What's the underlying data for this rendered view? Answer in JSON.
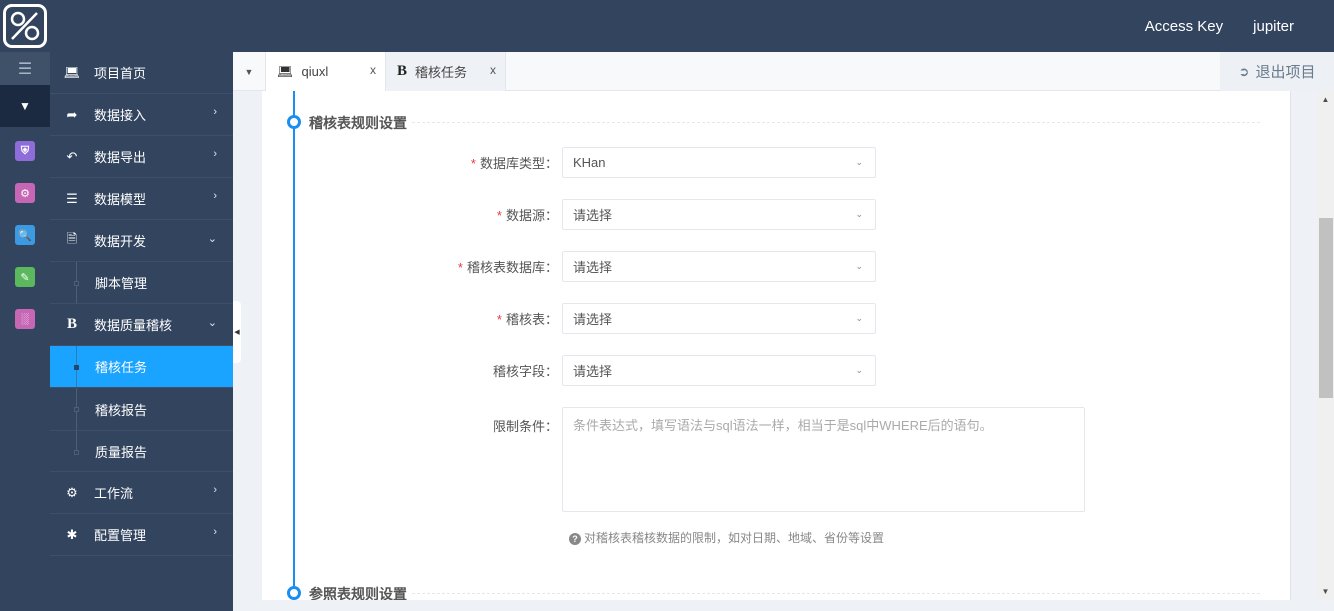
{
  "header": {
    "logo_icon": "percent-logo",
    "access_key_label": "Access Key",
    "username": "jupiter"
  },
  "rail": {
    "items": [
      {
        "icon": "shield-icon",
        "color": "#8e6ddb"
      },
      {
        "icon": "calendar-gear-icon",
        "color": "#c667b5"
      },
      {
        "icon": "folder-search-icon",
        "color": "#3b9ae1"
      },
      {
        "icon": "database-edit-icon",
        "color": "#5cb85c"
      },
      {
        "icon": "bar-chart-icon",
        "color": "#c667b5"
      }
    ]
  },
  "sidebar": {
    "items": [
      {
        "label": "项目首页",
        "icon": "monitor-icon",
        "arrow": ""
      },
      {
        "label": "数据接入",
        "icon": "share-icon",
        "arrow": "›"
      },
      {
        "label": "数据导出",
        "icon": "reply-icon",
        "arrow": "›"
      },
      {
        "label": "数据模型",
        "icon": "database-icon",
        "arrow": "›"
      },
      {
        "label": "数据开发",
        "icon": "file-code-icon",
        "arrow": "⌄"
      },
      {
        "label": "数据质量稽核",
        "icon": "bold-b-icon",
        "arrow": "⌄"
      },
      {
        "label": "工作流",
        "icon": "cogs-icon",
        "arrow": "›"
      },
      {
        "label": "配置管理",
        "icon": "gear-icon",
        "arrow": "›"
      }
    ],
    "dev_sub": [
      {
        "label": "脚本管理"
      }
    ],
    "quality_sub": [
      {
        "label": "稽核任务",
        "active": true
      },
      {
        "label": "稽核报告",
        "active": false
      },
      {
        "label": "质量报告",
        "active": false
      }
    ]
  },
  "tabs": [
    {
      "label": "qiuxl",
      "icon": "monitor-icon",
      "close": "x"
    },
    {
      "label": "稽核任务",
      "icon": "bold-b-icon",
      "close": "x"
    }
  ],
  "exit_button": {
    "label": "退出项目",
    "icon": "sign-out-icon"
  },
  "form": {
    "section1_title": "稽核表规则设置",
    "section2_title": "参照表规则设置",
    "fields": [
      {
        "label": "数据库类型：",
        "required": true,
        "value": "KHan"
      },
      {
        "label": "数据源：",
        "required": true,
        "value": "请选择"
      },
      {
        "label": "稽核表数据库：",
        "required": true,
        "value": "请选择"
      },
      {
        "label": "稽核表：",
        "required": true,
        "value": "请选择"
      },
      {
        "label": "稽核字段：",
        "required": false,
        "value": "请选择"
      }
    ],
    "condition": {
      "label": "限制条件：",
      "placeholder": "条件表达式，填写语法与sql语法一样，相当于是sql中WHERE后的语句。",
      "value": ""
    },
    "help_text": "对稽核表稽核数据的限制，如对日期、地域、省份等设置",
    "required_mark": "*"
  }
}
